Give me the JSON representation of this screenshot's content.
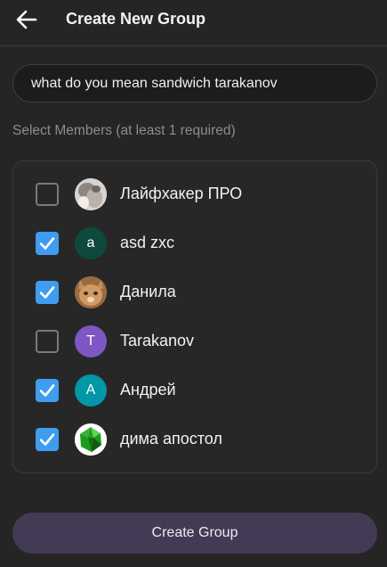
{
  "header": {
    "title": "Create New Group",
    "back_icon": "arrow-left-icon"
  },
  "group_name": {
    "value": "what do you mean sandwich tarakanov",
    "placeholder": "Group Name"
  },
  "members_label": "Select Members (at least 1 required)",
  "members": [
    {
      "name": "Лайфхакер ПРО",
      "checked": false,
      "avatar": {
        "type": "photo",
        "initial": "",
        "color": "#d9d4cf"
      }
    },
    {
      "name": "asd zxc",
      "checked": true,
      "avatar": {
        "type": "initial",
        "initial": "a",
        "color": "#0d4a3d"
      }
    },
    {
      "name": "Данила",
      "checked": true,
      "avatar": {
        "type": "photo",
        "initial": "",
        "color": "#b07a4c"
      }
    },
    {
      "name": "Tarakanov",
      "checked": false,
      "avatar": {
        "type": "initial",
        "initial": "T",
        "color": "#7e57c2"
      }
    },
    {
      "name": "Андрей",
      "checked": true,
      "avatar": {
        "type": "initial",
        "initial": "A",
        "color": "#0097a7"
      }
    },
    {
      "name": "дима апостол",
      "checked": true,
      "avatar": {
        "type": "photo",
        "initial": "",
        "color": "#1e8f1e"
      }
    }
  ],
  "colors": {
    "background": "#252525",
    "checkbox_checked": "#3f9cf0",
    "create_button": "#433a56"
  },
  "create_button_label": "Create Group"
}
